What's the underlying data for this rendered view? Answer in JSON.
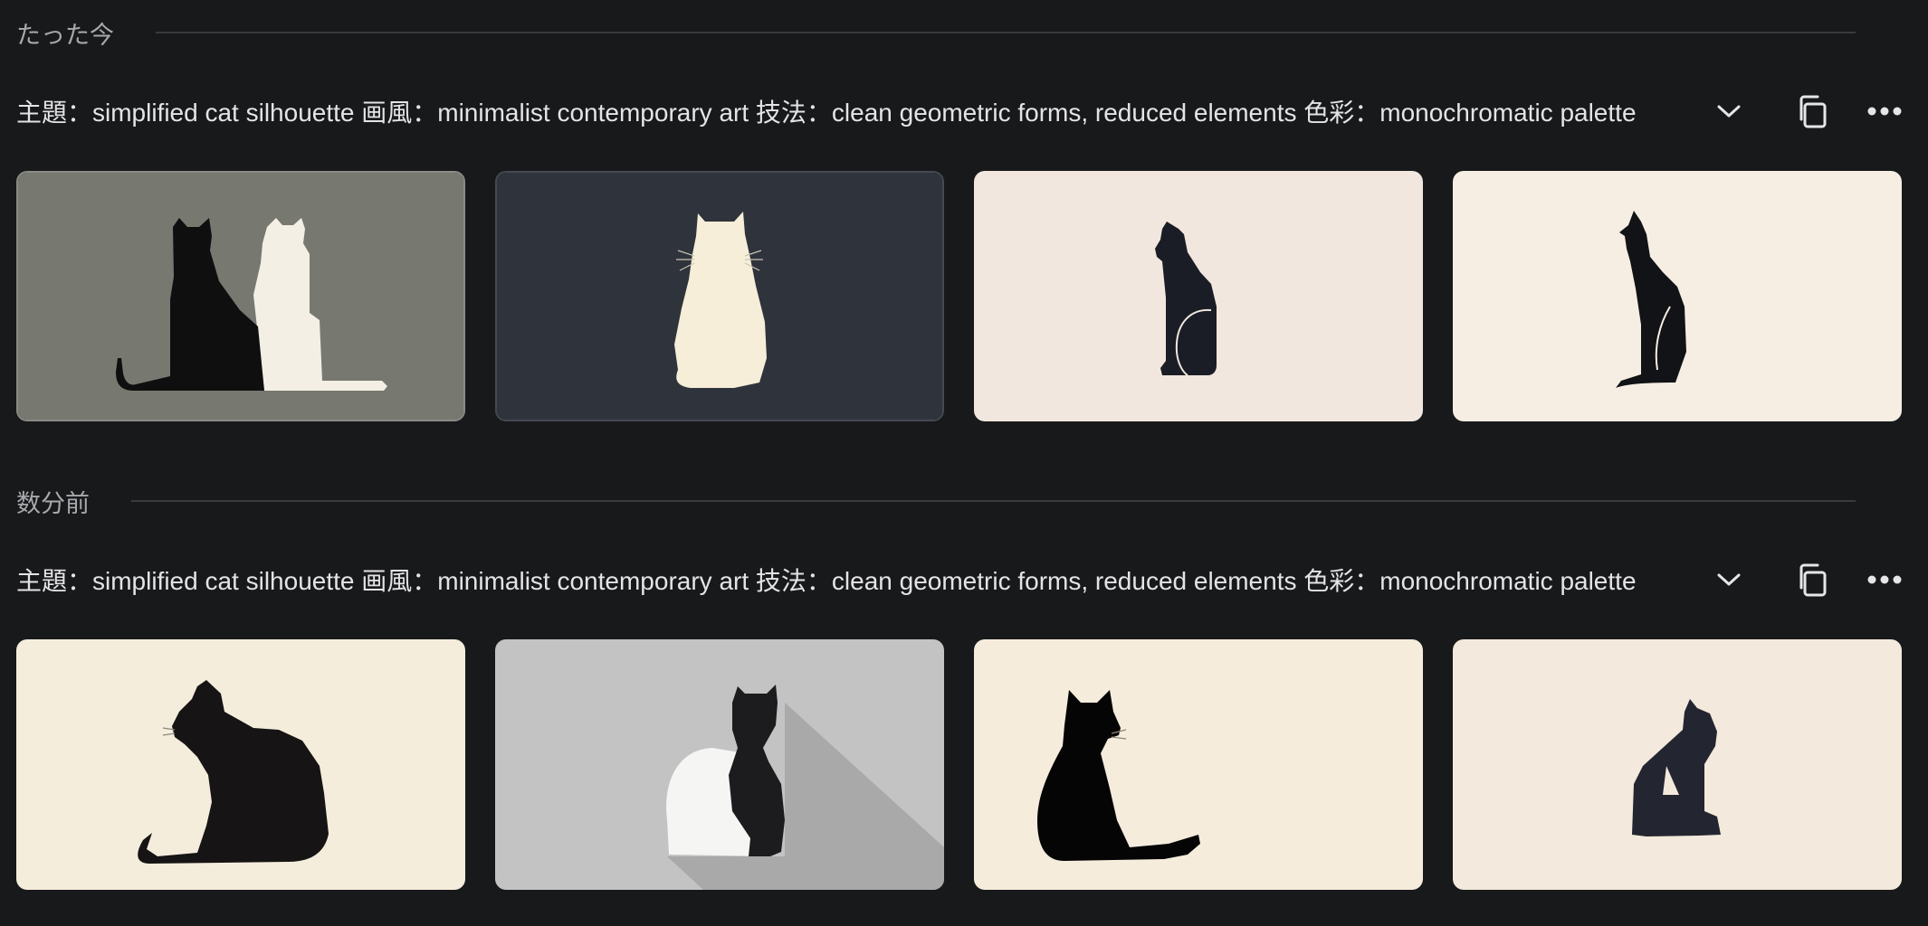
{
  "groups": [
    {
      "time_label": "たった今",
      "prompt": "主題：simplified cat silhouette 画風：minimalist contemporary art 技法：clean geometric forms, reduced elements 色彩：monochromatic palette",
      "images": [
        {
          "subject": "two-cats-black-cream",
          "background": "#777870"
        },
        {
          "subject": "cream-cat-back-view",
          "background": "#2f333b"
        },
        {
          "subject": "black-cat-sitting-side",
          "background": "#f1e7de"
        },
        {
          "subject": "black-cat-profile-tail",
          "background": "#f6eee2"
        }
      ]
    },
    {
      "time_label": "数分前",
      "prompt": "主題：simplified cat silhouette 画風：minimalist contemporary art 技法：clean geometric forms, reduced elements 色彩：monochromatic palette",
      "images": [
        {
          "subject": "black-cat-crouching",
          "background": "#f5eddc"
        },
        {
          "subject": "black-white-cat-shadow",
          "background": "#c3c3c3"
        },
        {
          "subject": "black-cat-looking-right",
          "background": "#f5ecdc"
        },
        {
          "subject": "small-geometric-cat",
          "background": "#f3e9dc"
        }
      ]
    }
  ],
  "icons": {
    "expand": "chevron-down-icon",
    "copy": "copy-icon",
    "more": "more-horizontal-icon"
  }
}
